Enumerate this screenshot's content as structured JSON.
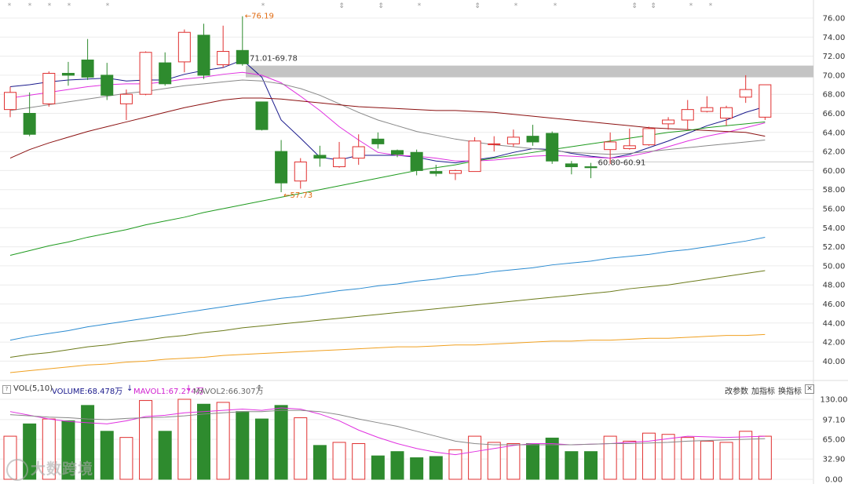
{
  "chart_data": {
    "type": "candlestick",
    "price_axis": {
      "ticks": [
        "76.00",
        "74.00",
        "72.00",
        "70.00",
        "68.00",
        "66.00",
        "64.00",
        "62.00",
        "60.00",
        "58.00",
        "56.00",
        "54.00",
        "52.00",
        "50.00",
        "48.00",
        "46.00",
        "44.00",
        "42.00",
        "40.00"
      ],
      "ylim": [
        39,
        77
      ]
    },
    "volume_axis": {
      "ticks": [
        "130.00",
        "97.10",
        "65.00",
        "32.90",
        "0.00"
      ],
      "ylim": [
        0,
        130
      ]
    },
    "candles": [
      {
        "o": 66.4,
        "h": 68.8,
        "l": 65.6,
        "c": 68.2
      },
      {
        "o": 66.0,
        "h": 68.2,
        "l": 63.6,
        "c": 63.8
      },
      {
        "o": 67.0,
        "h": 70.4,
        "l": 66.7,
        "c": 70.2
      },
      {
        "o": 70.2,
        "h": 71.4,
        "l": 68.9,
        "c": 70.0
      },
      {
        "o": 71.6,
        "h": 73.8,
        "l": 69.5,
        "c": 69.8
      },
      {
        "o": 70.0,
        "h": 71.3,
        "l": 67.4,
        "c": 67.9
      },
      {
        "o": 67.0,
        "h": 68.5,
        "l": 65.3,
        "c": 68.0
      },
      {
        "o": 68.0,
        "h": 72.5,
        "l": 67.9,
        "c": 72.4
      },
      {
        "o": 71.3,
        "h": 72.4,
        "l": 68.9,
        "c": 69.1
      },
      {
        "o": 71.4,
        "h": 74.8,
        "l": 70.3,
        "c": 74.5
      },
      {
        "o": 74.2,
        "h": 75.4,
        "l": 69.6,
        "c": 70.0
      },
      {
        "o": 71.1,
        "h": 75.2,
        "l": 70.8,
        "c": 72.5
      },
      {
        "o": 72.6,
        "h": 76.19,
        "l": 71.0,
        "c": 71.2
      },
      {
        "o": 67.2,
        "h": 67.2,
        "l": 64.2,
        "c": 64.3
      },
      {
        "o": 62.0,
        "h": 63.2,
        "l": 57.73,
        "c": 58.7
      },
      {
        "o": 58.9,
        "h": 61.3,
        "l": 58.1,
        "c": 60.9
      },
      {
        "o": 61.6,
        "h": 62.6,
        "l": 60.4,
        "c": 61.3
      },
      {
        "o": 60.4,
        "h": 63.0,
        "l": 60.3,
        "c": 61.3
      },
      {
        "o": 61.3,
        "h": 63.8,
        "l": 60.6,
        "c": 62.5
      },
      {
        "o": 63.3,
        "h": 64.0,
        "l": 62.3,
        "c": 62.8
      },
      {
        "o": 62.1,
        "h": 62.2,
        "l": 61.4,
        "c": 61.7
      },
      {
        "o": 61.9,
        "h": 62.2,
        "l": 59.5,
        "c": 60.0
      },
      {
        "o": 59.9,
        "h": 60.6,
        "l": 59.4,
        "c": 59.7
      },
      {
        "o": 59.7,
        "h": 60.1,
        "l": 59.0,
        "c": 60.0
      },
      {
        "o": 59.9,
        "h": 63.5,
        "l": 59.9,
        "c": 63.1
      },
      {
        "o": 62.8,
        "h": 63.6,
        "l": 62.0,
        "c": 62.8
      },
      {
        "o": 62.8,
        "h": 64.3,
        "l": 62.5,
        "c": 63.5
      },
      {
        "o": 63.6,
        "h": 64.8,
        "l": 62.6,
        "c": 63.0
      },
      {
        "o": 63.9,
        "h": 64.1,
        "l": 60.7,
        "c": 61.0
      },
      {
        "o": 60.7,
        "h": 61.0,
        "l": 59.6,
        "c": 60.4
      },
      {
        "o": 60.4,
        "h": 60.8,
        "l": 59.2,
        "c": 60.3
      },
      {
        "o": 62.2,
        "h": 64.0,
        "l": 60.7,
        "c": 63.0
      },
      {
        "o": 62.3,
        "h": 64.4,
        "l": 62.2,
        "c": 62.6
      },
      {
        "o": 62.7,
        "h": 64.6,
        "l": 62.6,
        "c": 64.4
      },
      {
        "o": 64.9,
        "h": 65.6,
        "l": 64.3,
        "c": 65.3
      },
      {
        "o": 65.3,
        "h": 67.4,
        "l": 64.3,
        "c": 66.4
      },
      {
        "o": 66.2,
        "h": 67.8,
        "l": 66.1,
        "c": 66.6
      },
      {
        "o": 65.5,
        "h": 66.8,
        "l": 64.7,
        "c": 66.6
      },
      {
        "o": 67.7,
        "h": 70.0,
        "l": 67.1,
        "c": 68.5
      },
      {
        "o": 65.6,
        "h": 69.0,
        "l": 65.3,
        "c": 69.0
      }
    ],
    "volumes": [
      70,
      90,
      98,
      95,
      120,
      78,
      68,
      128,
      78,
      130,
      122,
      125,
      110,
      98,
      120,
      100,
      55,
      60,
      58,
      38,
      45,
      35,
      37,
      48,
      70,
      60,
      58,
      58,
      67,
      45,
      45,
      70,
      62,
      75,
      73,
      68,
      62,
      60,
      78,
      70
    ],
    "price_lines": [
      {
        "color": "#1a1a8c",
        "values": [
          68.8,
          69.0,
          69.3,
          69.5,
          69.6,
          69.7,
          69.4,
          69.5,
          69.5,
          70.1,
          70.5,
          70.8,
          71.6,
          69.8,
          65.3,
          63.4,
          61.4,
          61.1,
          61.6,
          61.6,
          61.6,
          61.4,
          61.0,
          60.8,
          61.1,
          61.4,
          61.9,
          62.3,
          62.2,
          61.8,
          61.5,
          61.3,
          61.7,
          62.4,
          63.1,
          63.9,
          64.7,
          65.3,
          66.1,
          66.7
        ]
      },
      {
        "color": "#e030e0",
        "values": [
          67.6,
          67.9,
          68.2,
          68.5,
          68.8,
          69.0,
          69.1,
          69.1,
          69.3,
          69.6,
          69.8,
          70.1,
          70.3,
          70.0,
          69.2,
          67.8,
          66.3,
          64.6,
          63.2,
          61.9,
          61.6,
          61.5,
          61.3,
          61.0,
          61.0,
          61.1,
          61.3,
          61.5,
          61.6,
          61.5,
          61.4,
          61.3,
          61.5,
          61.9,
          62.5,
          63.1,
          63.6,
          64.0,
          64.5,
          65.0
        ]
      },
      {
        "color": "#888888",
        "values": [
          66.3,
          66.6,
          66.9,
          67.2,
          67.5,
          67.8,
          68.1,
          68.3,
          68.6,
          68.9,
          69.1,
          69.3,
          69.5,
          69.4,
          69.1,
          68.6,
          67.9,
          67.0,
          66.1,
          65.3,
          64.7,
          64.1,
          63.7,
          63.3,
          63.0,
          62.7,
          62.5,
          62.3,
          62.1,
          61.9,
          61.8,
          61.7,
          61.8,
          62.0,
          62.2,
          62.4,
          62.6,
          62.8,
          63.0,
          63.2
        ]
      },
      {
        "color": "#8b1010",
        "values": [
          61.3,
          62.2,
          62.9,
          63.5,
          64.1,
          64.6,
          65.1,
          65.6,
          66.1,
          66.6,
          67.0,
          67.4,
          67.6,
          67.6,
          67.5,
          67.3,
          67.1,
          66.9,
          66.7,
          66.6,
          66.5,
          66.4,
          66.3,
          66.3,
          66.2,
          66.1,
          65.9,
          65.7,
          65.5,
          65.3,
          65.1,
          64.9,
          64.7,
          64.5,
          64.4,
          64.3,
          64.2,
          64.1,
          64.0,
          63.6
        ]
      },
      {
        "color": "#1e9a1e",
        "values": [
          51.1,
          51.6,
          52.1,
          52.5,
          53.0,
          53.4,
          53.8,
          54.3,
          54.7,
          55.1,
          55.6,
          56.0,
          56.4,
          56.8,
          57.2,
          57.6,
          58.0,
          58.4,
          58.8,
          59.2,
          59.6,
          60.0,
          60.3,
          60.6,
          61.0,
          61.3,
          61.6,
          61.9,
          62.2,
          62.5,
          62.8,
          63.1,
          63.4,
          63.7,
          64.0,
          64.2,
          64.5,
          64.7,
          64.9,
          65.1
        ]
      },
      {
        "color": "#2a8ad0",
        "values": [
          42.2,
          42.6,
          42.9,
          43.2,
          43.6,
          43.9,
          44.2,
          44.5,
          44.8,
          45.1,
          45.4,
          45.7,
          46.0,
          46.3,
          46.6,
          46.8,
          47.1,
          47.4,
          47.6,
          47.9,
          48.1,
          48.4,
          48.6,
          48.9,
          49.1,
          49.4,
          49.6,
          49.8,
          50.1,
          50.3,
          50.5,
          50.8,
          51.0,
          51.2,
          51.5,
          51.7,
          52.0,
          52.3,
          52.6,
          53.0
        ]
      },
      {
        "color": "#6b7a1a",
        "values": [
          40.4,
          40.7,
          40.9,
          41.2,
          41.5,
          41.7,
          42.0,
          42.2,
          42.5,
          42.7,
          43.0,
          43.2,
          43.5,
          43.7,
          43.9,
          44.1,
          44.3,
          44.5,
          44.7,
          44.9,
          45.1,
          45.3,
          45.5,
          45.7,
          45.9,
          46.1,
          46.3,
          46.5,
          46.7,
          46.9,
          47.1,
          47.3,
          47.6,
          47.8,
          48.0,
          48.3,
          48.6,
          48.9,
          49.2,
          49.5
        ]
      },
      {
        "color": "#f0a020",
        "values": [
          38.8,
          39.0,
          39.2,
          39.4,
          39.6,
          39.7,
          39.9,
          40.0,
          40.2,
          40.3,
          40.4,
          40.6,
          40.7,
          40.8,
          40.9,
          41.0,
          41.1,
          41.2,
          41.3,
          41.4,
          41.5,
          41.5,
          41.6,
          41.7,
          41.7,
          41.8,
          41.9,
          42.0,
          42.1,
          42.1,
          42.2,
          42.2,
          42.3,
          42.4,
          42.4,
          42.5,
          42.6,
          42.7,
          42.7,
          42.8
        ]
      }
    ],
    "volume_lines": [
      {
        "color": "#e030e0",
        "values": [
          110,
          104,
          98,
          94,
          92,
          90,
          95,
          102,
          104,
          108,
          110,
          112,
          114,
          112,
          116,
          114,
          106,
          95,
          80,
          68,
          58,
          50,
          44,
          40,
          45,
          50,
          55,
          58,
          58,
          56,
          57,
          58,
          60,
          62,
          66,
          70,
          69,
          68,
          69,
          70
        ]
      },
      {
        "color": "#888888",
        "values": [
          105,
          103,
          101,
          100,
          98,
          97,
          99,
          100,
          101,
          103,
          106,
          108,
          110,
          110,
          112,
          112,
          110,
          105,
          98,
          92,
          86,
          78,
          70,
          62,
          58,
          56,
          56,
          56,
          56,
          56,
          57,
          58,
          58,
          59,
          60,
          62,
          63,
          64,
          65,
          66
        ]
      }
    ],
    "gray_band": [
      69.78,
      71.01
    ],
    "support_line": 60.91,
    "annotations": {
      "high_label": "76.19",
      "low_label": "57.73",
      "band_label": "71.01-69.78",
      "range_label": "60.80-60.91"
    },
    "event_marks": [
      "*",
      "*",
      "*",
      "*",
      "*",
      "*",
      "⇕",
      "⇕",
      "*",
      "⇕",
      "*",
      "*",
      "⇕",
      "⇕",
      "*",
      "*",
      "⇕"
    ]
  },
  "volume_bar": {
    "question": "?",
    "vol_label": "VOL(5,10)",
    "volume": "VOLUME:68.478万",
    "volume_arrow": "↓",
    "mavol1": "MAVOL1:67.274万",
    "mavol1_arrow": "↓",
    "mavol2": "MAVOL2:66.307万",
    "mavol2_arrow": "↑",
    "btn_params": "改参数",
    "btn_add": "加指标",
    "btn_switch": "换指标",
    "close": "✕"
  },
  "watermark": "大数跨境",
  "colors": {
    "up": "#e03030",
    "down": "#2e8b2e",
    "bg": "#ffffff",
    "grid": "#ececec"
  }
}
